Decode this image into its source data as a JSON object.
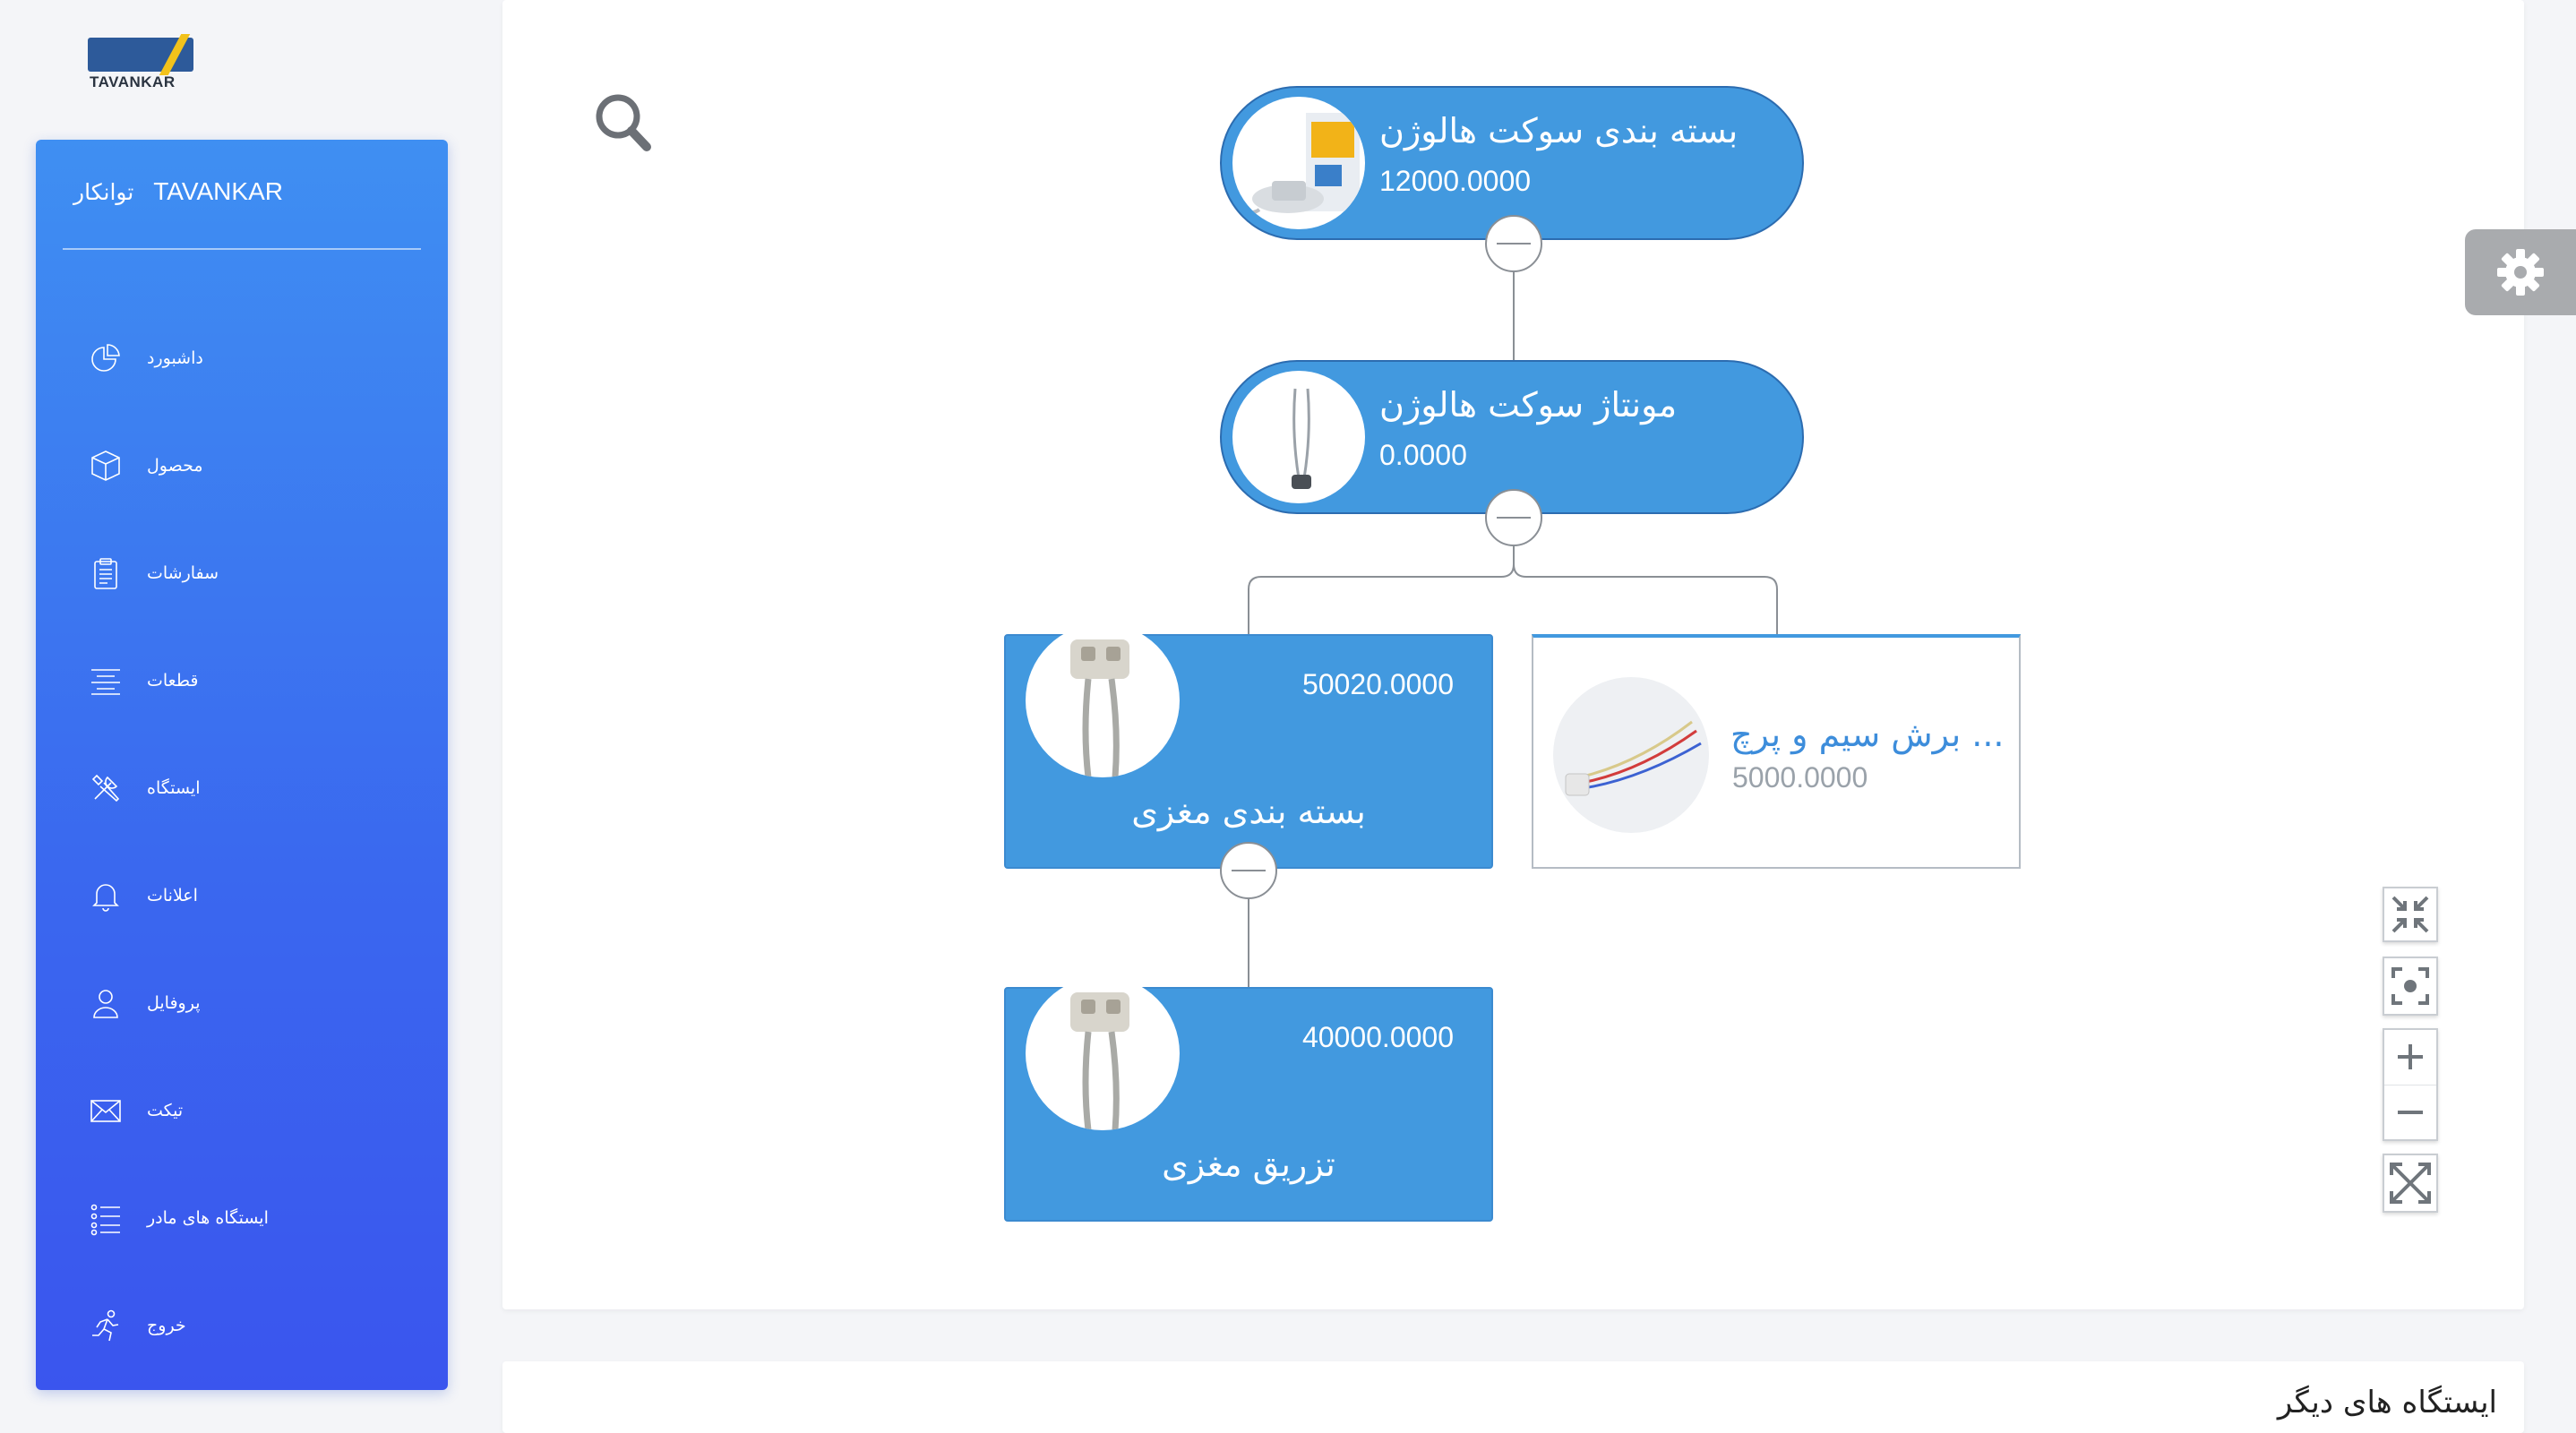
{
  "logo": {
    "text": "TAVANKAR"
  },
  "sidebar": {
    "brand_fa": "توانکار",
    "brand_en": "TAVANKAR",
    "items": [
      {
        "label": "داشبورد",
        "icon": "pie-chart-icon"
      },
      {
        "label": "محصول",
        "icon": "box-icon"
      },
      {
        "label": "سفارشات",
        "icon": "clipboard-icon"
      },
      {
        "label": "قطعات",
        "icon": "align-center-icon"
      },
      {
        "label": "ایستگاه",
        "icon": "tools-icon"
      },
      {
        "label": "اعلانات",
        "icon": "bell-icon"
      },
      {
        "label": "پروفایل",
        "icon": "user-icon"
      },
      {
        "label": "تیکت",
        "icon": "envelope-icon"
      },
      {
        "label": "ایستگاه های مادر",
        "icon": "list-icon"
      },
      {
        "label": "خروج",
        "icon": "running-icon"
      }
    ]
  },
  "tree": {
    "root": {
      "title": "بسته بندی سوکت هالوژن",
      "value": "12000.0000"
    },
    "level2": {
      "title": "مونتاژ سوکت هالوژن",
      "value": "0.0000"
    },
    "left": {
      "title": "بسته بندی مغزی",
      "value": "50020.0000"
    },
    "right": {
      "title": "... برش سیم و پرچ",
      "value": "5000.0000"
    },
    "bottom": {
      "title": "تزریق مغزی",
      "value": "40000.0000"
    }
  },
  "bottom_card": {
    "title": "ایستگاه های دیگر"
  },
  "colors": {
    "node_blue": "#4299df",
    "sidebar_top": "#3f8ff2",
    "sidebar_bottom": "#3a55ee"
  }
}
